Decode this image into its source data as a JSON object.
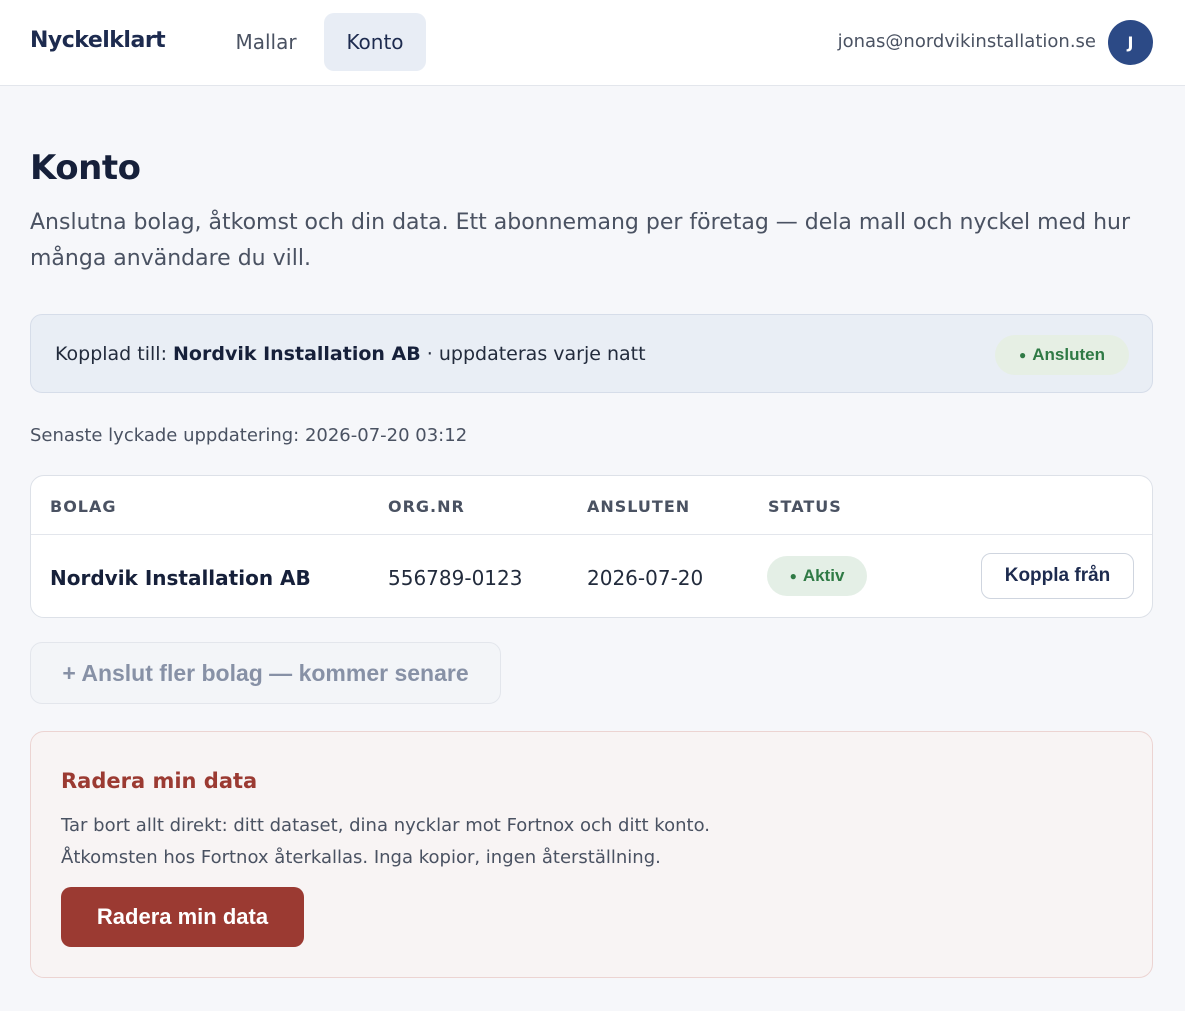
{
  "app": {
    "brand": "Nyckelklart"
  },
  "nav": {
    "tabs": [
      {
        "label": "Mallar",
        "active": false
      },
      {
        "label": "Konto",
        "active": true
      }
    ]
  },
  "user": {
    "email": "jonas@nordvikinstallation.se",
    "avatar_initial": "J"
  },
  "page": {
    "title": "Konto",
    "subtitle": "Anslutna bolag, åtkomst och din data. Ett abonnemang per företag — dela mall och nyckel med hur många användare du vill."
  },
  "connection": {
    "prefix": "Kopplad till: ",
    "company": "Nordvik Installation AB",
    "suffix": " · uppdateras varje natt",
    "status_dot": "●",
    "status_label": "Ansluten",
    "last_update": "Senaste lyckade uppdatering: 2026-07-20 03:12"
  },
  "table": {
    "headers": [
      "BOLAG",
      "ORG.NR",
      "ANSLUTEN",
      "STATUS"
    ],
    "rows": [
      {
        "company": "Nordvik Installation AB",
        "org_nr": "556789-0123",
        "connected": "2026-07-20",
        "status_dot": "●",
        "status": "Aktiv",
        "action": "Koppla från"
      }
    ]
  },
  "more_companies_label": "+ Anslut fler bolag — kommer senare",
  "danger": {
    "title": "Radera min data",
    "line1": "Tar bort allt direkt: ditt dataset, dina nycklar mot Fortnox och ditt konto.",
    "line2": "Åtkomsten hos Fortnox återkallas. Inga kopior, ingen återställning.",
    "button": "Radera min data"
  },
  "colors": {
    "brand": "#1d2b4f",
    "avatar": "#2c4a86",
    "success": "#2f7a45",
    "danger": "#9b3a32"
  }
}
